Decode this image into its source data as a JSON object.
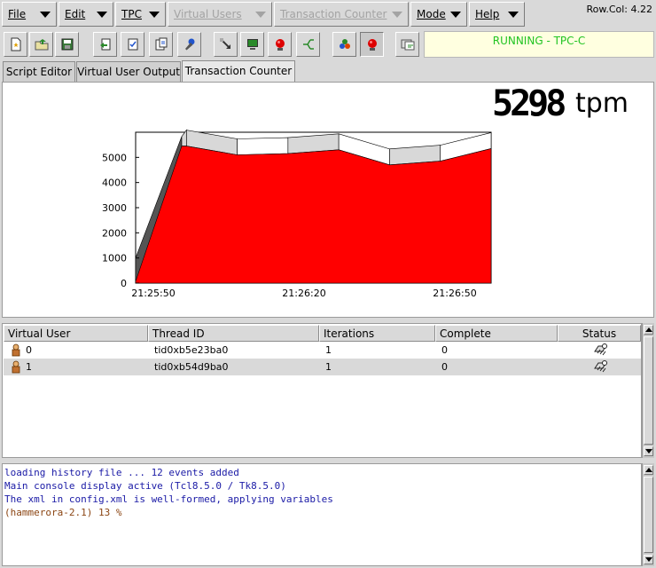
{
  "menu": {
    "items": [
      {
        "label": "File",
        "enabled": true
      },
      {
        "label": "Edit",
        "enabled": true
      },
      {
        "label": "TPC",
        "enabled": true
      },
      {
        "label": "Virtual Users",
        "enabled": false
      },
      {
        "label": "Transaction Counter",
        "enabled": false
      },
      {
        "label": "Mode",
        "enabled": true
      },
      {
        "label": "Help",
        "enabled": true
      }
    ]
  },
  "rowcol": "Row.Col:   4.22",
  "toolbar": {
    "icons": [
      "new-file-icon",
      "open-folder-icon",
      "save-icon",
      "load-script-icon",
      "build-schema-icon",
      "edit-options-icon",
      "wrench-icon",
      "run-arrow-icon",
      "terminal-icon",
      "stop-light-icon",
      "route-icon",
      "users-icon",
      "counter-icon",
      "refresh-icon"
    ]
  },
  "status": {
    "text": "RUNNING - TPC-C",
    "color": "#22c422"
  },
  "tabs": [
    {
      "label": "Script Editor",
      "active": false
    },
    {
      "label": "Virtual User Output",
      "active": false
    },
    {
      "label": "Transaction Counter",
      "active": true
    }
  ],
  "counter": {
    "value": "5298",
    "unit": "tpm"
  },
  "chart_data": {
    "type": "area",
    "x": [
      "21:25:50",
      "",
      "",
      "",
      "",
      "",
      "",
      "",
      ""
    ],
    "values": [
      0,
      5450,
      5100,
      5150,
      5300,
      4700,
      4850,
      5350
    ],
    "xticks": [
      "21:25:50",
      "21:26:20",
      "21:26:50"
    ],
    "yticks": [
      0,
      1000,
      2000,
      3000,
      4000,
      5000
    ],
    "ylim": [
      0,
      6000
    ],
    "fill_color": "#ff0000",
    "grid": false,
    "style": "3d"
  },
  "vusers": {
    "columns": [
      "Virtual User",
      "Thread ID",
      "Iterations",
      "Complete",
      "Status"
    ],
    "rows": [
      {
        "user": "0",
        "thread": "tid0xb5e23ba0",
        "iterations": "1",
        "complete": "0",
        "status_icon": "running-icon"
      },
      {
        "user": "1",
        "thread": "tid0xb54d9ba0",
        "iterations": "1",
        "complete": "0",
        "status_icon": "running-icon"
      }
    ]
  },
  "console": {
    "lines": [
      "loading history file ... 12 events added",
      "Main console display active (Tcl8.5.0 / Tk8.5.0)",
      "The xml in config.xml is well-formed, applying variables",
      "(hammerora-2.1) 13 %"
    ]
  }
}
